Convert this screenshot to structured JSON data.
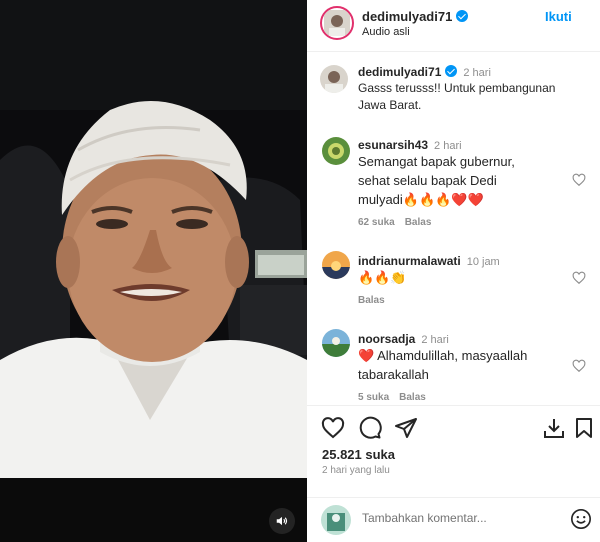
{
  "header": {
    "username": "dedimulyadi71",
    "subtitle": "Audio asli",
    "follow_label": "Ikuti"
  },
  "caption": {
    "username": "dedimulyadi71",
    "time": "2 hari",
    "text_line1": "Gasss terusss!! Untuk pembangunan",
    "text_line2": "Jawa Barat."
  },
  "comments": [
    {
      "username": "esunarsih43",
      "time": "2 hari",
      "line1": "Semangat bapak gubernur,",
      "line2": "sehat selalu bapak Dedi",
      "line3": "mulyadi🔥🔥🔥❤️❤️",
      "likes": "62 suka",
      "reply": "Balas"
    },
    {
      "username": "indrianurmalawati",
      "time": "10 jam",
      "line1": "🔥🔥👏",
      "reply": "Balas"
    },
    {
      "username": "noorsadja",
      "time": "2 hari",
      "line1": "❤️ Alhamdulillah, masyaallah",
      "line2": "tabarakallah",
      "likes": "5 suka",
      "reply": "Balas"
    }
  ],
  "icons": {
    "like": "heart-outline-icon",
    "comment": "comment-bubble-icon",
    "share": "paper-plane-icon",
    "download": "download-icon",
    "save": "bookmark-icon",
    "sound": "speaker-icon",
    "emoji": "smiley-icon"
  },
  "stats": {
    "likes": "25.821 suka",
    "time_ago": "2 hari yang lalu"
  },
  "composer": {
    "placeholder": "Tambahkan komentar..."
  },
  "colors": {
    "accent_blue": "#0095f6",
    "heart_red": "#ed4956",
    "muted_text": "#8e8e8e"
  }
}
